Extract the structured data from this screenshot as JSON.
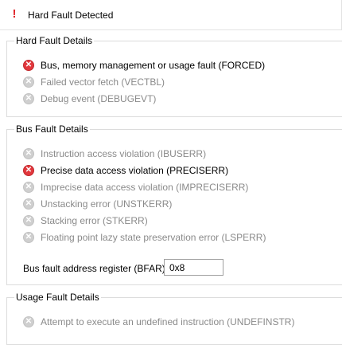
{
  "header": {
    "title": "Hard Fault Detected",
    "icon": "exclamation-icon"
  },
  "hard_fault": {
    "title": "Hard Fault Details",
    "items": [
      {
        "label": "Bus, memory management or usage fault (FORCED)",
        "active": true
      },
      {
        "label": "Failed vector fetch (VECTBL)",
        "active": false
      },
      {
        "label": "Debug event (DEBUGEVT)",
        "active": false
      }
    ]
  },
  "bus_fault": {
    "title": "Bus Fault Details",
    "items": [
      {
        "label": "Instruction access violation (IBUSERR)",
        "active": false
      },
      {
        "label": "Precise data access violation (PRECISERR)",
        "active": true
      },
      {
        "label": "Imprecise data access violation (IMPRECISERR)",
        "active": false
      },
      {
        "label": "Unstacking error (UNSTKERR)",
        "active": false
      },
      {
        "label": "Stacking error (STKERR)",
        "active": false
      },
      {
        "label": "Floating point lazy state preservation error (LSPERR)",
        "active": false
      }
    ],
    "bfar_label": "Bus fault address register (BFAR):",
    "bfar_value": "0x8"
  },
  "usage_fault": {
    "title": "Usage Fault Details",
    "items": [
      {
        "label": "Attempt to execute an undefined instruction (UNDEFINSTR)",
        "active": false
      }
    ]
  },
  "colors": {
    "active_icon": "#e2383d",
    "inactive_icon": "#cfcfcf",
    "warning": "#e0252b"
  }
}
